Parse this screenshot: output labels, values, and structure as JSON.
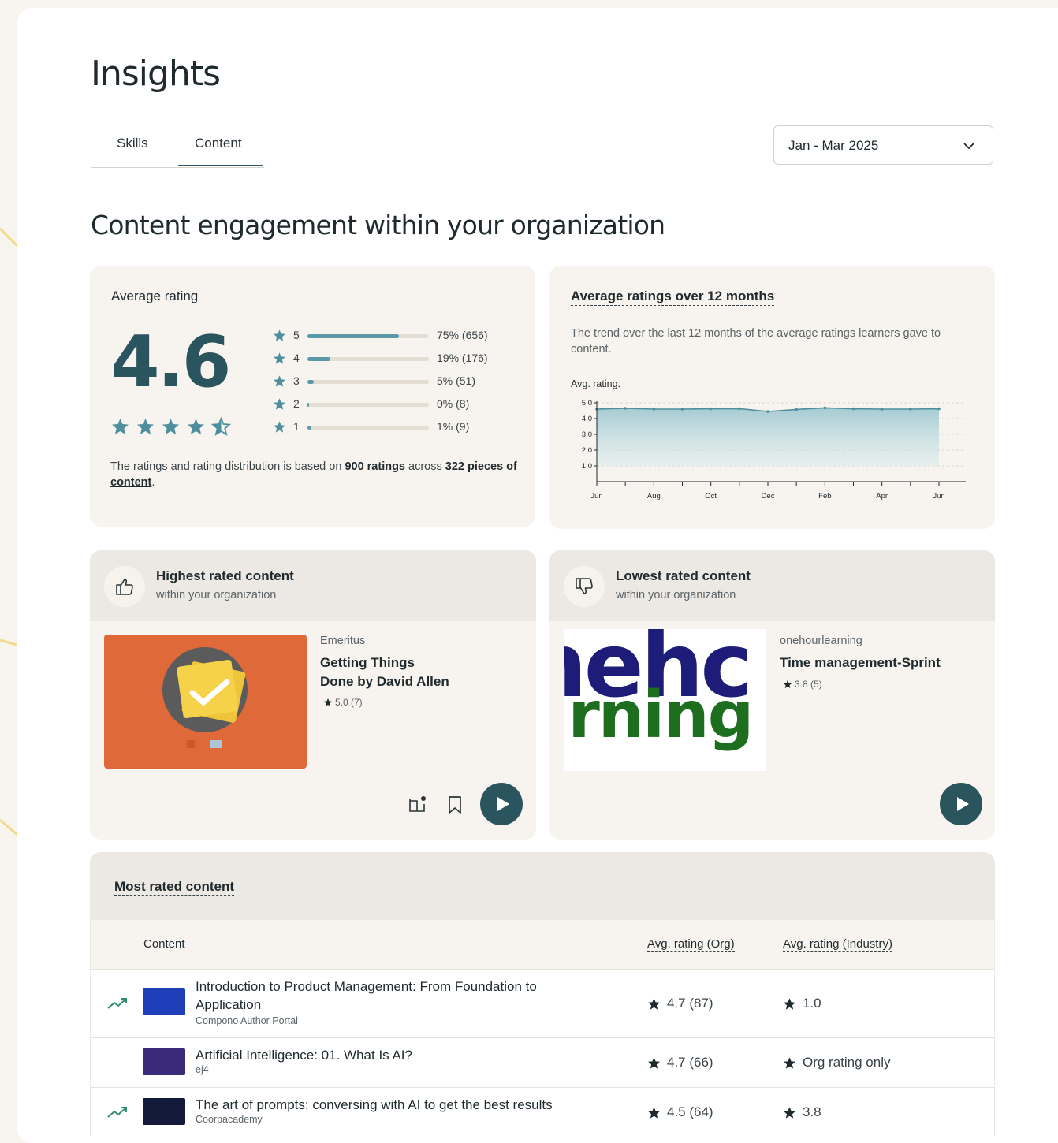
{
  "page": {
    "title": "Insights"
  },
  "tabs": [
    {
      "label": "Skills"
    },
    {
      "label": "Content",
      "active": true
    }
  ],
  "date_filter": {
    "value": "Jan - Mar 2025"
  },
  "section": {
    "title": "Content engagement within your organization"
  },
  "average_rating": {
    "label": "Average rating",
    "value": "4.6",
    "distribution": [
      {
        "stars": "5",
        "fraction": 0.75,
        "text": "75% (656)"
      },
      {
        "stars": "4",
        "fraction": 0.19,
        "text": "19% (176)"
      },
      {
        "stars": "3",
        "fraction": 0.05,
        "text": "5% (51)"
      },
      {
        "stars": "2",
        "fraction": 0.0,
        "text": "0% (8)"
      },
      {
        "stars": "1",
        "fraction": 0.01,
        "text": "1% (9)"
      }
    ],
    "footnote": {
      "pre": "The ratings and rating distribution is based on ",
      "ratings": "900 ratings",
      "mid": " across ",
      "pieces": "322 pieces of content",
      "post": "."
    }
  },
  "trend": {
    "title": "Average ratings over 12 months",
    "description": "The trend over the last 12 months of the average ratings learners gave to content.",
    "axis_label": "Avg. rating."
  },
  "chart_data": {
    "type": "area",
    "ylabel": "Avg. rating.",
    "ylim": [
      0,
      5
    ],
    "yticks": [
      "5.0",
      "4.0",
      "3.0",
      "2.0",
      "1.0"
    ],
    "x_ticks": [
      "Jun",
      "Aug",
      "Oct",
      "Dec",
      "Feb",
      "Apr",
      "Jun"
    ],
    "series": [
      {
        "values": [
          4.6,
          4.65,
          4.6,
          4.6,
          4.62,
          4.63,
          4.45,
          4.58,
          4.68,
          4.62,
          4.6,
          4.6,
          4.62
        ]
      }
    ],
    "grid": true
  },
  "highest": {
    "title": "Highest rated content",
    "subtitle": "within your organization",
    "provider": "Emeritus",
    "course_title_line1": "Getting Things",
    "course_title_line2": "Done by David Allen",
    "rating": "5.0 (7)"
  },
  "lowest": {
    "title": "Lowest rated content",
    "subtitle": "within your organization",
    "thumb_line1": "nehc",
    "thumb_line2": "arning",
    "provider": "onehourlearning",
    "course_title": "Time management-Sprint",
    "rating": "3.8 (5)"
  },
  "most_rated": {
    "title": "Most rated content",
    "columns": {
      "content": "Content",
      "org": "Avg. rating (Org)",
      "industry": "Avg. rating (Industry)"
    },
    "rows": [
      {
        "title_line1": "Introduction to Product Management: From Foundation to",
        "title_line2": "Application",
        "source": "Compono Author Portal",
        "org": "4.7 (87)",
        "industry": "1.0",
        "trending": true,
        "thumb_color": "#1e3fb8"
      },
      {
        "title_line1": "Artificial Intelligence: 01. What Is AI?",
        "title_line2": "",
        "source": "ej4",
        "org": "4.7 (66)",
        "industry": "Org rating only",
        "trending": false,
        "thumb_color": "#3b2a7a"
      },
      {
        "title_line1": "The art of prompts: conversing with AI to get the best results",
        "title_line2": "",
        "source": "Coorpacademy",
        "org": "4.5 (64)",
        "industry": "3.8",
        "trending": true,
        "thumb_color": "#141a3a"
      }
    ]
  },
  "colors": {
    "accent": "#2b555e",
    "bar": "#5a9aa8",
    "deco_line": "#f3d98a",
    "thumb_orange": "#e0693a"
  }
}
